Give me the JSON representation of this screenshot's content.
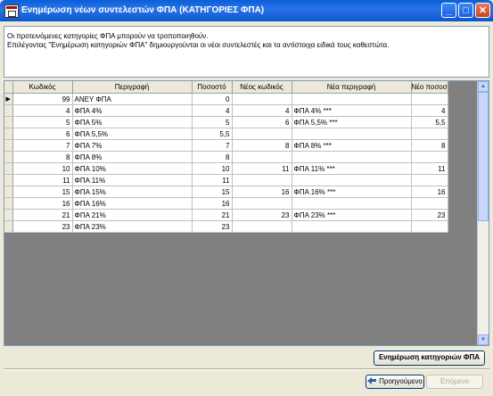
{
  "window": {
    "title": "Ενημέρωση νέων συντελεστών ΦΠΑ (ΚΑΤΗΓΟΡΙΕΣ ΦΠΑ)",
    "controls": {
      "minimize": "_",
      "maximize": "□",
      "close": "✕"
    }
  },
  "info": {
    "line1": "Οι προτεινόμενες κατηγορίες ΦΠΑ μπορούν να τροποποιηθούν.",
    "line2": "Επιλέγοντας \"Ενημέρωση κατηγοριών ΦΠΑ\" δημιουργούνται οι νέοι συντελεστές και τα αντίστοιχα ειδικά τους καθεστώτα."
  },
  "grid": {
    "columns": [
      "Κωδικός",
      "Περιγραφή",
      "Ποσοστό",
      "Νέος κωδικός",
      "Νέα περιγραφή",
      "Νέο ποσοστό"
    ],
    "current_row_marker": "▶",
    "rows": [
      {
        "code": "99",
        "desc": "ΑΝΕΥ ΦΠΑ",
        "rate": "0",
        "new_code": "",
        "new_desc": "",
        "new_rate": ""
      },
      {
        "code": "4",
        "desc": "ΦΠΑ 4%",
        "rate": "4",
        "new_code": "4",
        "new_desc": "ΦΠΑ 4% ***",
        "new_rate": "4"
      },
      {
        "code": "5",
        "desc": "ΦΠΑ 5%",
        "rate": "5",
        "new_code": "6",
        "new_desc": "ΦΠΑ 5,5% ***",
        "new_rate": "5,5"
      },
      {
        "code": "6",
        "desc": "ΦΠΑ 5,5%",
        "rate": "5,5",
        "new_code": "",
        "new_desc": "",
        "new_rate": ""
      },
      {
        "code": "7",
        "desc": "ΦΠΑ 7%",
        "rate": "7",
        "new_code": "8",
        "new_desc": "ΦΠΑ 8% ***",
        "new_rate": "8"
      },
      {
        "code": "8",
        "desc": "ΦΠΑ 8%",
        "rate": "8",
        "new_code": "",
        "new_desc": "",
        "new_rate": ""
      },
      {
        "code": "10",
        "desc": "ΦΠΑ 10%",
        "rate": "10",
        "new_code": "11",
        "new_desc": "ΦΠΑ 11% ***",
        "new_rate": "11"
      },
      {
        "code": "11",
        "desc": "ΦΠΑ 11%",
        "rate": "11",
        "new_code": "",
        "new_desc": "",
        "new_rate": ""
      },
      {
        "code": "15",
        "desc": "ΦΠΑ 15%",
        "rate": "15",
        "new_code": "16",
        "new_desc": "ΦΠΑ 16% ***",
        "new_rate": "16"
      },
      {
        "code": "16",
        "desc": "ΦΠΑ 16%",
        "rate": "16",
        "new_code": "",
        "new_desc": "",
        "new_rate": ""
      },
      {
        "code": "21",
        "desc": "ΦΠΑ 21%",
        "rate": "21",
        "new_code": "23",
        "new_desc": "ΦΠΑ 23% ***",
        "new_rate": "23"
      },
      {
        "code": "23",
        "desc": "ΦΠΑ 23%",
        "rate": "23",
        "new_code": "",
        "new_desc": "",
        "new_rate": ""
      }
    ]
  },
  "actions": {
    "update_label": "Ενημέρωση κατηγοριών ΦΠΑ",
    "previous_label": "Προηγούμενο",
    "next_label": "Επόμενο"
  }
}
